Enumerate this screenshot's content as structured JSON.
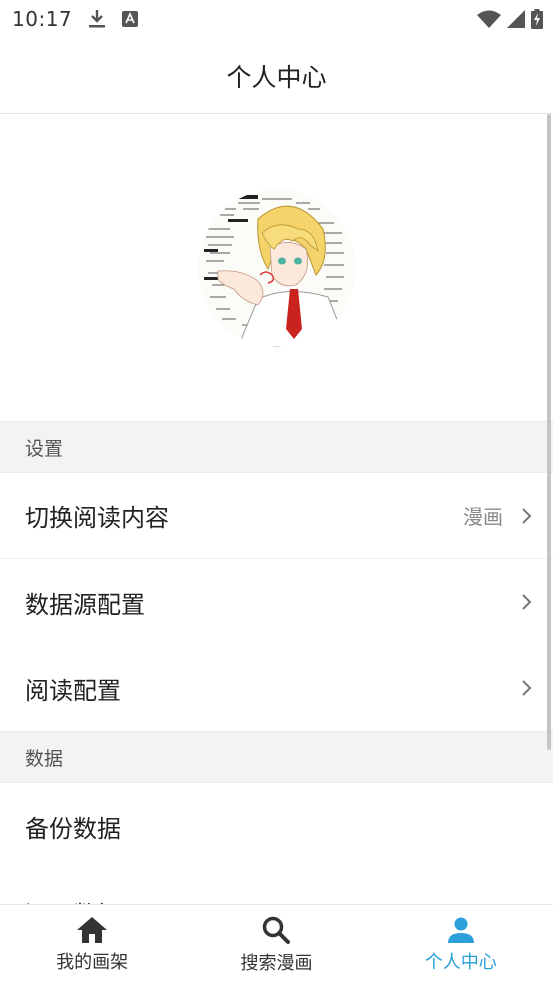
{
  "status_bar": {
    "time": "10:17",
    "icons": [
      "download-icon",
      "a-badge-icon",
      "wifi-icon",
      "cell-signal-icon",
      "battery-charging-icon"
    ]
  },
  "header": {
    "title": "个人中心"
  },
  "profile": {
    "avatar_icon": "anime-character-avatar"
  },
  "sections": {
    "settings": {
      "label": "设置",
      "items": [
        {
          "label": "切换阅读内容",
          "value": "漫画"
        },
        {
          "label": "数据源配置"
        },
        {
          "label": "阅读配置"
        }
      ]
    },
    "data": {
      "label": "数据",
      "items": [
        {
          "label": "备份数据"
        },
        {
          "label": "还原数据"
        }
      ]
    }
  },
  "bottom_nav": {
    "items": [
      {
        "label": "我的画架",
        "icon": "home-icon"
      },
      {
        "label": "搜索漫画",
        "icon": "search-icon"
      },
      {
        "label": "个人中心",
        "icon": "person-icon"
      }
    ],
    "active_index": 2
  },
  "colors": {
    "accent": "#2ba0d9",
    "section_bg": "#f2f3f5",
    "text": "#222222"
  }
}
